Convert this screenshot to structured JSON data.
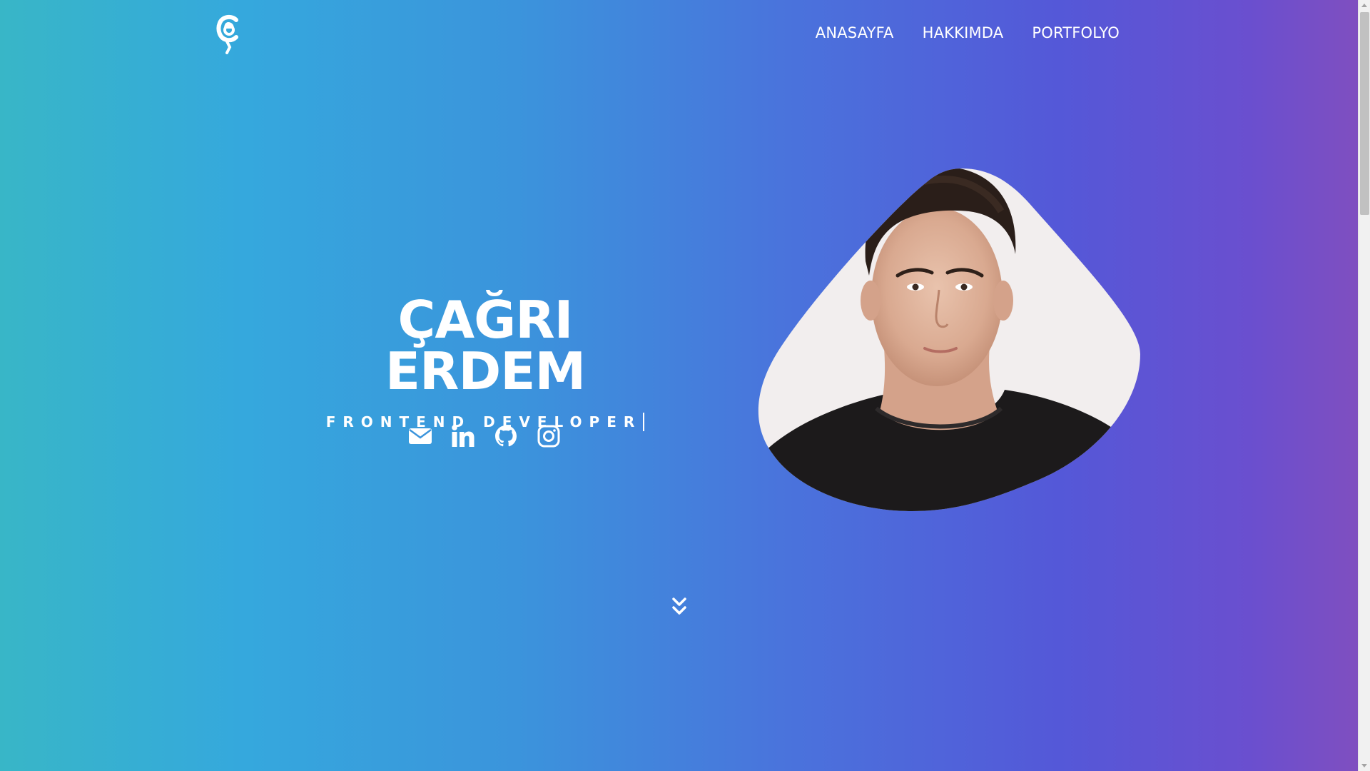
{
  "header": {
    "logo_icon": "ce-logo",
    "nav": [
      {
        "label": "ANASAYFA"
      },
      {
        "label": "HAKKIMDA"
      },
      {
        "label": "PORTFOLYO"
      }
    ]
  },
  "hero": {
    "name": "ÇAĞRI ERDEM",
    "role": "FRONTEND DEVELOPER",
    "socials": [
      {
        "icon": "envelope-icon"
      },
      {
        "icon": "linkedin-icon"
      },
      {
        "icon": "github-icon"
      },
      {
        "icon": "instagram-icon"
      }
    ],
    "portrait_icon": "profile-photo",
    "scroll_icon": "double-chevron-down-icon"
  },
  "colors": {
    "gradient_start": "#38b6c7",
    "gradient_mid": "#3b94dc",
    "gradient_end": "#7f4fc0",
    "text": "#ffffff"
  }
}
